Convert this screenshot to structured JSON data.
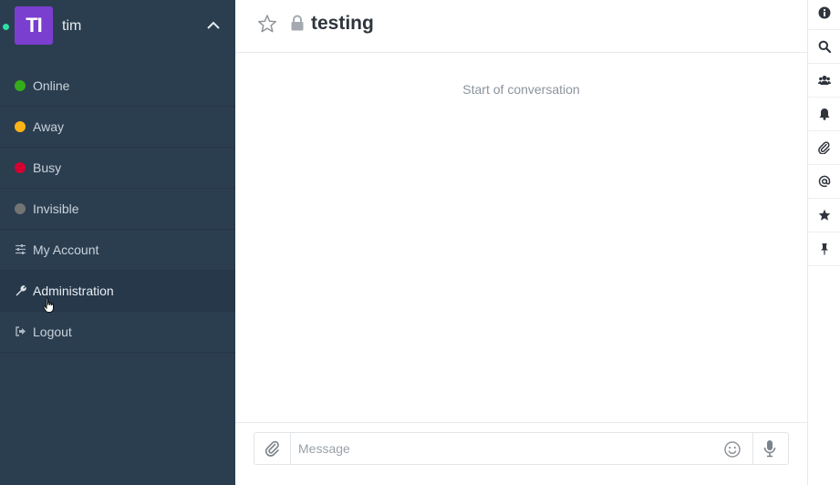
{
  "user": {
    "initials": "TI",
    "name": "tim",
    "avatar_color": "#7a3fcf",
    "status_color": "#2de0a5"
  },
  "status_menu": [
    {
      "label": "Online",
      "color": "#35ac19"
    },
    {
      "label": "Away",
      "color": "#fcb316"
    },
    {
      "label": "Busy",
      "color": "#d30230"
    },
    {
      "label": "Invisible",
      "color": "#747474"
    }
  ],
  "account_menu": [
    {
      "label": "My Account",
      "icon": "sliders-icon"
    },
    {
      "label": "Administration",
      "icon": "wrench-icon"
    },
    {
      "label": "Logout",
      "icon": "logout-icon"
    }
  ],
  "room": {
    "name": "testing",
    "start_text": "Start of conversation"
  },
  "composer": {
    "placeholder": "Message"
  },
  "toolbar": [
    "info-icon",
    "search-icon",
    "members-icon",
    "bell-icon",
    "paperclip-icon",
    "at-icon",
    "star-icon",
    "pin-icon"
  ]
}
